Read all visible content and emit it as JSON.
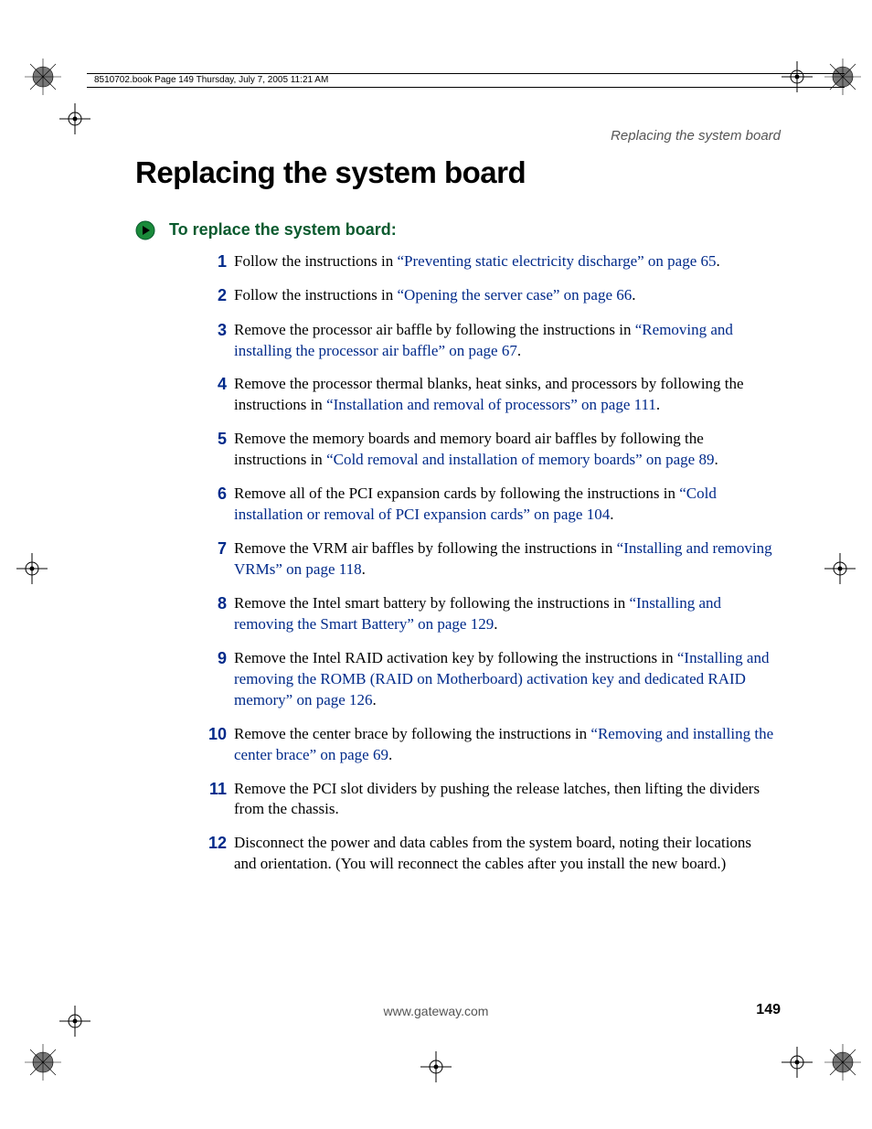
{
  "header": {
    "text": "8510702.book  Page 149  Thursday, July 7, 2005  11:21 AM"
  },
  "running_head": "Replacing the system board",
  "title": "Replacing the system board",
  "subtitle": "To replace the system board:",
  "steps": [
    {
      "num": "1",
      "pre": "Follow the instructions in ",
      "link": "“Preventing static electricity discharge” on page 65",
      "post": "."
    },
    {
      "num": "2",
      "pre": "Follow the instructions in ",
      "link": "“Opening the server case” on page 66",
      "post": "."
    },
    {
      "num": "3",
      "pre": "Remove the processor air baffle by following the instructions in ",
      "link": "“Removing and installing the processor air baffle” on page 67",
      "post": "."
    },
    {
      "num": "4",
      "pre": "Remove the processor thermal blanks, heat sinks, and processors by following the instructions in ",
      "link": "“Installation and removal of processors” on page 111",
      "post": "."
    },
    {
      "num": "5",
      "pre": "Remove the memory boards and memory board air baffles by following the instructions in ",
      "link": "“Cold removal and installation of memory boards” on page 89",
      "post": "."
    },
    {
      "num": "6",
      "pre": "Remove all of the PCI expansion cards by following the instructions in ",
      "link": "“Cold installation or removal of PCI expansion cards” on page 104",
      "post": "."
    },
    {
      "num": "7",
      "pre": "Remove the VRM air baffles by following the instructions in ",
      "link": "“Installing and removing VRMs” on page 118",
      "post": "."
    },
    {
      "num": "8",
      "pre": "Remove the Intel smart battery by following the instructions in ",
      "link": "“Installing and removing the Smart Battery” on page 129",
      "post": "."
    },
    {
      "num": "9",
      "pre": "Remove the Intel RAID activation key by following the instructions in ",
      "link": "“Installing and removing the ROMB (RAID on Motherboard) activation key and dedicated RAID memory” on page 126",
      "post": "."
    },
    {
      "num": "10",
      "pre": "Remove the center brace by following the instructions in ",
      "link": "“Removing and installing the center brace” on page 69",
      "post": "."
    },
    {
      "num": "11",
      "pre": "Remove the PCI slot dividers by pushing the release latches, then lifting the dividers from the chassis.",
      "link": "",
      "post": ""
    },
    {
      "num": "12",
      "pre": "Disconnect the power and data cables from the system board, noting their locations and orientation. (You will reconnect the cables after you install the new board.)",
      "link": "",
      "post": ""
    }
  ],
  "footer": {
    "url": "www.gateway.com",
    "page": "149"
  }
}
